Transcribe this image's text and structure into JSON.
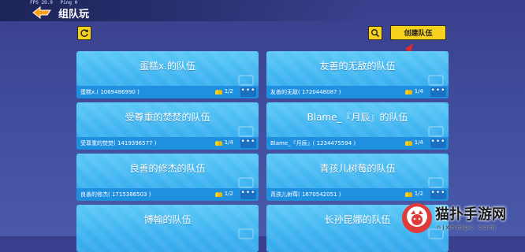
{
  "header": {
    "fps": "FPS 29.9",
    "ping": "Ping 0",
    "title": "组队玩"
  },
  "toolbar": {
    "refresh_icon": "refresh-icon",
    "search_icon": "search-icon",
    "create_label": "创建队伍"
  },
  "teams": [
    {
      "name": "蛋糕x.的队伍",
      "leader": "蛋糕x.( 1069486990 )",
      "count": "1/2"
    },
    {
      "name": "友善的无敌的队伍",
      "leader": "友善的无敌( 1720448087 )",
      "count": "1/4"
    },
    {
      "name": "受尊重的焚焚的队伍",
      "leader": "受尊重的焚焚( 1419396577 )",
      "count": "1/4"
    },
    {
      "name": "Blame_『月辰』的队伍",
      "leader": "Blame_『月辰』( 1234475594 )",
      "count": "1/4"
    },
    {
      "name": "良善的修杰的队伍",
      "leader": "良善的修杰( 1715386503 )",
      "count": "1/2"
    },
    {
      "name": "青孩儿树莓的队伍",
      "leader": "青孩儿树莓( 1670542051 )",
      "count": "1/2"
    },
    {
      "name": "博翰的队伍",
      "leader": "",
      "count": ""
    },
    {
      "name": "长孙昆娜的队伍",
      "leader": "",
      "count": ""
    }
  ],
  "more_label": "•••",
  "watermark": {
    "title": "猫扑手游网",
    "sub": "njxhmpc.com"
  },
  "colors": {
    "accent_yellow": "#f7d21d",
    "card_blue": "#3fb4f1",
    "card_bar": "#1f8fe0",
    "arrow_red": "#e02a2a"
  }
}
